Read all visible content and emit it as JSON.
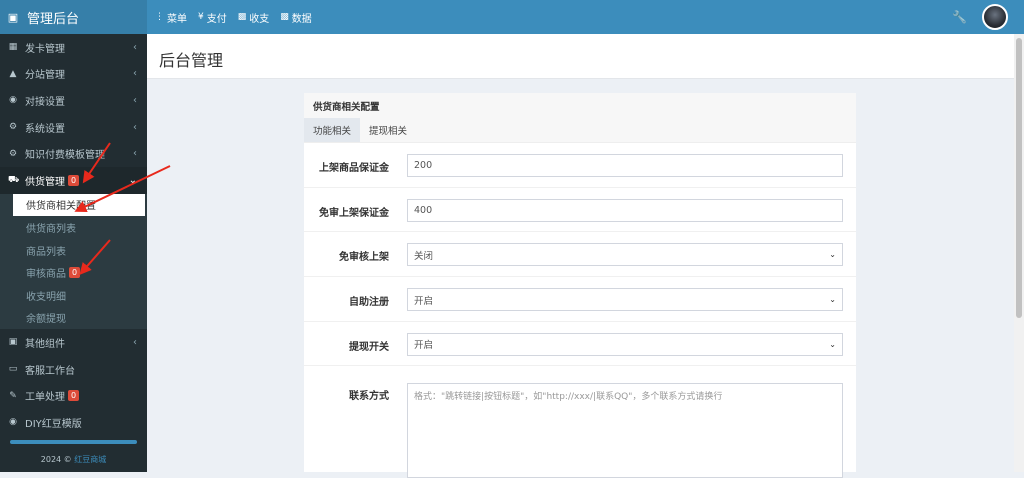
{
  "header": {
    "app_title": "管理后台",
    "nav": [
      {
        "icon": "list-icon",
        "label": "菜单"
      },
      {
        "icon": "yen-icon",
        "label": "支付"
      },
      {
        "icon": "wallet-icon",
        "label": "收支"
      },
      {
        "icon": "bar-chart-icon",
        "label": "数据"
      }
    ]
  },
  "sidebar": {
    "items": [
      {
        "icon": "grid-icon",
        "label": "发卡管理"
      },
      {
        "icon": "sitemap-icon",
        "label": "分站管理"
      },
      {
        "icon": "handshake-icon",
        "label": "对接设置"
      },
      {
        "icon": "gear-icon",
        "label": "系统设置"
      },
      {
        "icon": "cogs-icon",
        "label": "知识付费模板管理"
      },
      {
        "icon": "truck-icon",
        "label": "供货管理",
        "badge": "0"
      }
    ],
    "submenu": [
      {
        "label": "供货商相关配置"
      },
      {
        "label": "供货商列表"
      },
      {
        "label": "商品列表"
      },
      {
        "label": "审核商品",
        "badge": "0"
      },
      {
        "label": "收支明细"
      },
      {
        "label": "余额提现"
      }
    ],
    "bottom_items": [
      {
        "icon": "cube-icon",
        "label": "其他组件"
      },
      {
        "icon": "laptop-icon",
        "label": "客服工作台"
      },
      {
        "icon": "edit-icon",
        "label": "工单处理",
        "badge": "0"
      },
      {
        "icon": "paint-icon",
        "label": "DIY红豆模版"
      }
    ],
    "copyright_prefix": "2024 ©",
    "copyright_link": "红豆商城"
  },
  "page": {
    "title": "后台管理"
  },
  "panel": {
    "title": "供货商相关配置",
    "tabs": [
      "功能相关",
      "提现相关"
    ],
    "fields": [
      {
        "label": "上架商品保证金",
        "value": "200",
        "type": "input"
      },
      {
        "label": "免审上架保证金",
        "value": "400",
        "type": "input"
      },
      {
        "label": "免审核上架",
        "value": "关闭",
        "type": "select"
      },
      {
        "label": "自助注册",
        "value": "开启",
        "type": "select"
      },
      {
        "label": "提现开关",
        "value": "开启",
        "type": "select"
      }
    ],
    "contact_label": "联系方式",
    "contact_placeholder": "格式：\"跳转链接|按钮标题\"，如\"http://xxx/|联系QQ\"，多个联系方式请换行"
  }
}
